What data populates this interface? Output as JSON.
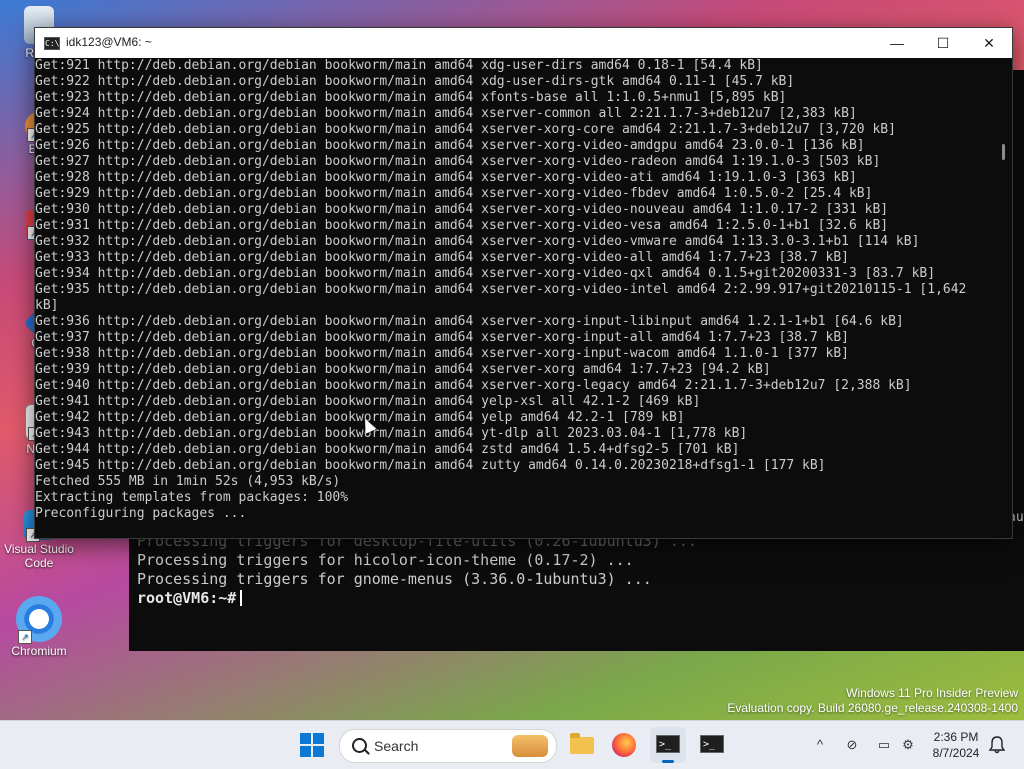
{
  "desktop": {
    "icons": [
      {
        "label": "Recy",
        "name": "recycle-bin"
      },
      {
        "label": "Eve",
        "name": "everything"
      },
      {
        "label": "Fl",
        "name": "flutter"
      },
      {
        "label": "Git",
        "name": "git"
      },
      {
        "label": "Note",
        "name": "notepad"
      },
      {
        "label": "Visual Studio Code",
        "name": "vscode"
      },
      {
        "label": "Chromium",
        "name": "chromium"
      }
    ]
  },
  "window": {
    "title": "idk123@VM6: ~",
    "controls": {
      "minimize": "—",
      "maximize": "☐",
      "close": "✕"
    },
    "output": "Get:921 http://deb.debian.org/debian bookworm/main amd64 xdg-user-dirs amd64 0.18-1 [54.4 kB]\nGet:922 http://deb.debian.org/debian bookworm/main amd64 xdg-user-dirs-gtk amd64 0.11-1 [45.7 kB]\nGet:923 http://deb.debian.org/debian bookworm/main amd64 xfonts-base all 1:1.0.5+nmu1 [5,895 kB]\nGet:924 http://deb.debian.org/debian bookworm/main amd64 xserver-common all 2:21.1.7-3+deb12u7 [2,383 kB]\nGet:925 http://deb.debian.org/debian bookworm/main amd64 xserver-xorg-core amd64 2:21.1.7-3+deb12u7 [3,720 kB]\nGet:926 http://deb.debian.org/debian bookworm/main amd64 xserver-xorg-video-amdgpu amd64 23.0.0-1 [136 kB]\nGet:927 http://deb.debian.org/debian bookworm/main amd64 xserver-xorg-video-radeon amd64 1:19.1.0-3 [503 kB]\nGet:928 http://deb.debian.org/debian bookworm/main amd64 xserver-xorg-video-ati amd64 1:19.1.0-3 [363 kB]\nGet:929 http://deb.debian.org/debian bookworm/main amd64 xserver-xorg-video-fbdev amd64 1:0.5.0-2 [25.4 kB]\nGet:930 http://deb.debian.org/debian bookworm/main amd64 xserver-xorg-video-nouveau amd64 1:1.0.17-2 [331 kB]\nGet:931 http://deb.debian.org/debian bookworm/main amd64 xserver-xorg-video-vesa amd64 1:2.5.0-1+b1 [32.6 kB]\nGet:932 http://deb.debian.org/debian bookworm/main amd64 xserver-xorg-video-vmware amd64 1:13.3.0-3.1+b1 [114 kB]\nGet:933 http://deb.debian.org/debian bookworm/main amd64 xserver-xorg-video-all amd64 1:7.7+23 [38.7 kB]\nGet:934 http://deb.debian.org/debian bookworm/main amd64 xserver-xorg-video-qxl amd64 0.1.5+git20200331-3 [83.7 kB]\nGet:935 http://deb.debian.org/debian bookworm/main amd64 xserver-xorg-video-intel amd64 2:2.99.917+git20210115-1 [1,642\nkB]\nGet:936 http://deb.debian.org/debian bookworm/main amd64 xserver-xorg-input-libinput amd64 1.2.1-1+b1 [64.6 kB]\nGet:937 http://deb.debian.org/debian bookworm/main amd64 xserver-xorg-input-all amd64 1:7.7+23 [38.7 kB]\nGet:938 http://deb.debian.org/debian bookworm/main amd64 xserver-xorg-input-wacom amd64 1.1.0-1 [377 kB]\nGet:939 http://deb.debian.org/debian bookworm/main amd64 xserver-xorg amd64 1:7.7+23 [94.2 kB]\nGet:940 http://deb.debian.org/debian bookworm/main amd64 xserver-xorg-legacy amd64 2:21.1.7-3+deb12u7 [2,388 kB]\nGet:941 http://deb.debian.org/debian bookworm/main amd64 yelp-xsl all 42.1-2 [469 kB]\nGet:942 http://deb.debian.org/debian bookworm/main amd64 yelp amd64 42.2-1 [789 kB]\nGet:943 http://deb.debian.org/debian bookworm/main amd64 yt-dlp all 2023.03.04-1 [1,778 kB]\nGet:944 http://deb.debian.org/debian bookworm/main amd64 zstd amd64 1.5.4+dfsg2-5 [701 kB]\nGet:945 http://deb.debian.org/debian bookworm/main amd64 zutty amd64 0.14.0.20230218+dfsg1-1 [177 kB]\nFetched 555 MB in 1min 52s (4,953 kB/s)\nExtracting templates from packages: 100%\nPreconfiguring packages ..."
  },
  "background_terminal": {
    "partial_line": "Processing triggers for desktop-file-utils (0.26-1ubuntu3) ...",
    "line1": "Processing triggers for hicolor-icon-theme (0.17-2) ...",
    "line2": "Processing triggers for gnome-menus (3.36.0-1ubuntu3) ...",
    "prompt": "root@VM6:~#",
    "right_fragment": "au"
  },
  "watermark": {
    "line1": "Windows 11 Pro Insider Preview",
    "line2": "Evaluation copy. Build 26080.ge_release.240308-1400"
  },
  "taskbar": {
    "search_label": "Search",
    "tray_chevron": "^",
    "time": "2:36 PM",
    "date": "8/7/2024"
  },
  "colors": {
    "terminal_bg": "#0c0c0c",
    "terminal_fg": "#cccccc",
    "accent": "#0067c0"
  }
}
